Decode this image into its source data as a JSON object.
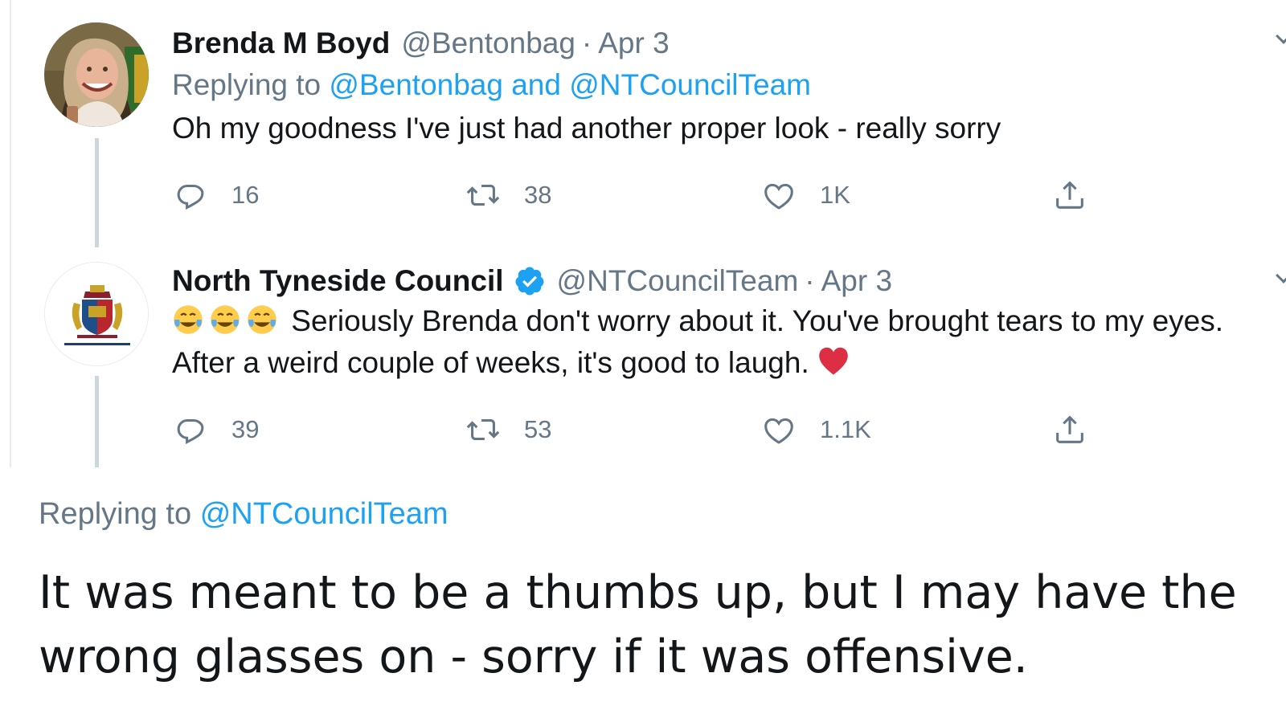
{
  "colors": {
    "link": "#1da1f2",
    "muted": "#657786",
    "text": "#14171a",
    "verified": "#1da1f2",
    "heart_emoji": "#dd2e44"
  },
  "thread": [
    {
      "author": {
        "display_name": "Brenda M Boyd",
        "handle": "@Bentonbag",
        "date": "Apr 3",
        "avatar_icon": "profile-photo"
      },
      "replying": {
        "prefix": "Replying to",
        "handles": "@Bentonbag and @NTCouncilTeam"
      },
      "text": "Oh my goodness I've just had another proper look - really sorry",
      "actions": {
        "replies": "16",
        "retweets": "38",
        "likes": "1K"
      }
    },
    {
      "author": {
        "display_name": "North Tyneside Council",
        "verified_icon": "verified-badge-icon",
        "handle": "@NTCouncilTeam",
        "date": "Apr 3",
        "avatar_icon": "council-crest-logo"
      },
      "text_emojis": [
        "tears-of-joy-emoji",
        "tears-of-joy-emoji",
        "tears-of-joy-emoji"
      ],
      "text": "Seriously Brenda don't worry about it. You've brought tears to my eyes. After a weird couple of weeks, it's good to laugh.",
      "text_trailing_emoji": "red-heart-emoji",
      "actions": {
        "replies": "39",
        "retweets": "53",
        "likes": "1.1K"
      }
    }
  ],
  "main_tweet": {
    "replying_prefix": "Replying to",
    "replying_handle": "@NTCouncilTeam",
    "text": "It was meant to be a thumbs up, but I may have the wrong glasses on - sorry if it was offensive."
  }
}
